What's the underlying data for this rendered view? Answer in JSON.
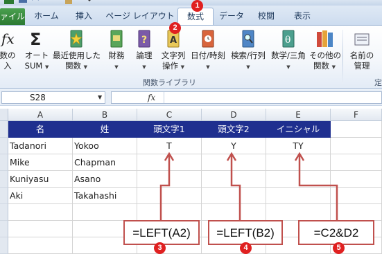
{
  "colors": {
    "accent_red": "#c0504d",
    "header_fill": "#1f2f8f",
    "header_text": "#ffffff",
    "file_tab": "#2c7a32"
  },
  "ribbon": {
    "tabs": [
      {
        "label": "ァイル",
        "kind": "file"
      },
      {
        "label": "ホーム"
      },
      {
        "label": "挿入"
      },
      {
        "label": "ページ レイアウト"
      },
      {
        "label": "数式",
        "active": true
      },
      {
        "label": "データ"
      },
      {
        "label": "校閲"
      },
      {
        "label": "表示"
      }
    ],
    "buttons": [
      {
        "name": "insert-function-button",
        "line1": "数の",
        "line2": "入",
        "icon": "fx-icon"
      },
      {
        "name": "autosum-button",
        "line1": "オート",
        "line2": "SUM",
        "icon": "sigma-icon",
        "dropdown": true
      },
      {
        "name": "recently-used-button",
        "line1": "最近使用した",
        "line2": "関数",
        "icon": "star-book-icon",
        "dropdown": true
      },
      {
        "name": "financial-button",
        "line1": "財務",
        "line2": "",
        "icon": "money-book-icon",
        "dropdown": true
      },
      {
        "name": "logical-button",
        "line1": "論理",
        "line2": "",
        "icon": "question-book-icon",
        "dropdown": true
      },
      {
        "name": "text-button",
        "line1": "文字列",
        "line2": "操作",
        "icon": "text-book-icon",
        "dropdown": true
      },
      {
        "name": "datetime-button",
        "line1": "日付/時刻",
        "line2": "",
        "icon": "clock-book-icon",
        "dropdown": true
      },
      {
        "name": "lookup-button",
        "line1": "検索/行列",
        "line2": "",
        "icon": "magnifier-book-icon",
        "dropdown": true
      },
      {
        "name": "math-button",
        "line1": "数学/三角",
        "line2": "",
        "icon": "theta-book-icon",
        "dropdown": true
      },
      {
        "name": "more-functions-button",
        "line1": "その他の",
        "line2": "関数",
        "icon": "books-icon",
        "dropdown": true
      },
      {
        "name": "name-manager-button",
        "line1": "名前の",
        "line2": "管理",
        "icon": "name-manager-icon"
      }
    ],
    "group_label": "関数ライブラリ",
    "group_label_2": "定"
  },
  "formula_bar": {
    "name_box": "S28",
    "fx": "fx",
    "formula": ""
  },
  "sheet": {
    "columns": [
      "A",
      "B",
      "C",
      "D",
      "E",
      "F"
    ],
    "header_row": [
      "名",
      "姓",
      "頭文字1",
      "頭文字2",
      "イニシャル"
    ],
    "rows": [
      [
        "Tadanori",
        "Yokoo",
        "T",
        "Y",
        "TY"
      ],
      [
        "Mike",
        "Chapman",
        "",
        "",
        ""
      ],
      [
        "Kuniyasu",
        "Asano",
        "",
        "",
        ""
      ],
      [
        "Aki",
        "Takahashi",
        "",
        "",
        ""
      ]
    ]
  },
  "annotations": {
    "badges": [
      "1",
      "2",
      "3",
      "4",
      "5"
    ],
    "formulas": [
      "=LEFT(A2)",
      "=LEFT(B2)",
      "=C2&D2"
    ]
  }
}
